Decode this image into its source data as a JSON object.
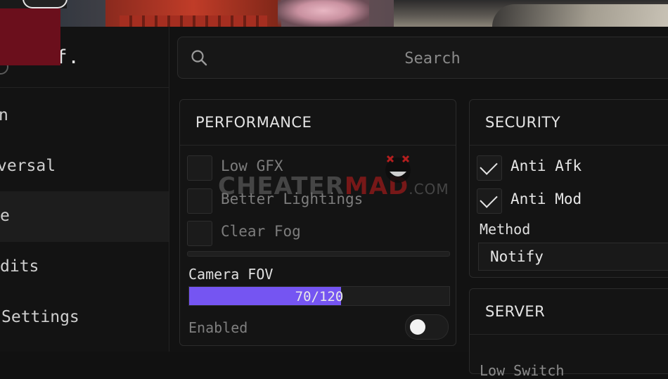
{
  "brand": {
    "logo_text": "ff."
  },
  "sidebar": {
    "items": [
      {
        "label": "n"
      },
      {
        "label": "versal"
      },
      {
        "label": "e"
      },
      {
        "label": "dits"
      },
      {
        "label": "Settings"
      }
    ],
    "active_index": 2
  },
  "search": {
    "placeholder": "Search"
  },
  "performance": {
    "title": "PERFORMANCE",
    "options": [
      {
        "label": "Low GFX",
        "checked": false
      },
      {
        "label": "Better Lightings",
        "checked": false
      },
      {
        "label": "Clear Fog",
        "checked": false
      }
    ],
    "fov": {
      "label": "Camera FOV",
      "value_text": "70/120",
      "value": 70,
      "max": 120
    },
    "enabled": {
      "label": "Enabled",
      "on": false
    }
  },
  "security": {
    "title": "SECURITY",
    "options": [
      {
        "label": "Anti Afk",
        "checked": true
      },
      {
        "label": "Anti Mod",
        "checked": true
      }
    ],
    "method": {
      "label": "Method",
      "value": "Notify"
    }
  },
  "server": {
    "title": "SERVER",
    "sub_label": "Low Switch"
  },
  "watermark": {
    "part1": "CHEATER",
    "part2": "MAD",
    "part3": ".COM"
  },
  "colors": {
    "accent": "#7555f2",
    "logo_block": "#6b0f1c",
    "panel_bg": "#121212"
  }
}
